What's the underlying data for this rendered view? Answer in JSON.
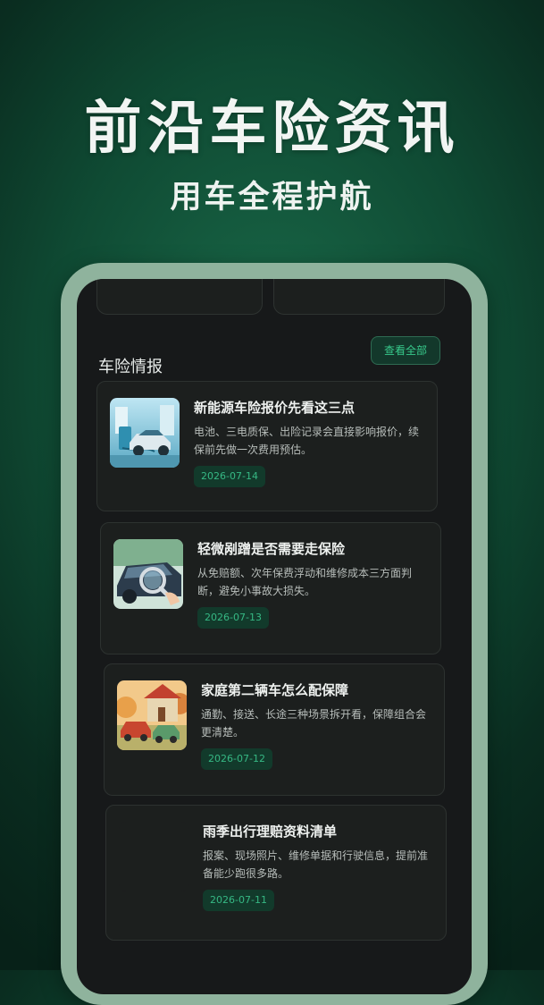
{
  "hero": {
    "title": "前沿车险资讯",
    "subtitle": "用车全程护航"
  },
  "section": {
    "title": "车险情报",
    "view_all": "查看全部"
  },
  "news": [
    {
      "title": "新能源车险报价先看这三点",
      "desc": "电池、三电质保、出险记录会直接影响报价，续保前先做一次费用预估。",
      "date": "2026-07-14",
      "icon": "ev-charging-icon"
    },
    {
      "title": "轻微剐蹭是否需要走保险",
      "desc": "从免赔额、次年保费浮动和维修成本三方面判断，避免小事故大损失。",
      "date": "2026-07-13",
      "icon": "car-inspection-icon"
    },
    {
      "title": "家庭第二辆车怎么配保障",
      "desc": "通勤、接送、长途三种场景拆开看，保障组合会更清楚。",
      "date": "2026-07-12",
      "icon": "family-cars-icon"
    },
    {
      "title": "雨季出行理赔资料清单",
      "desc": "报案、现场照片、维修单据和行驶信息，提前准备能少跑很多路。",
      "date": "2026-07-11",
      "icon": ""
    }
  ],
  "colors": {
    "accent": "#36b884",
    "background": "#0f4a33",
    "screen": "#17191a",
    "frame": "#8fb39d"
  }
}
